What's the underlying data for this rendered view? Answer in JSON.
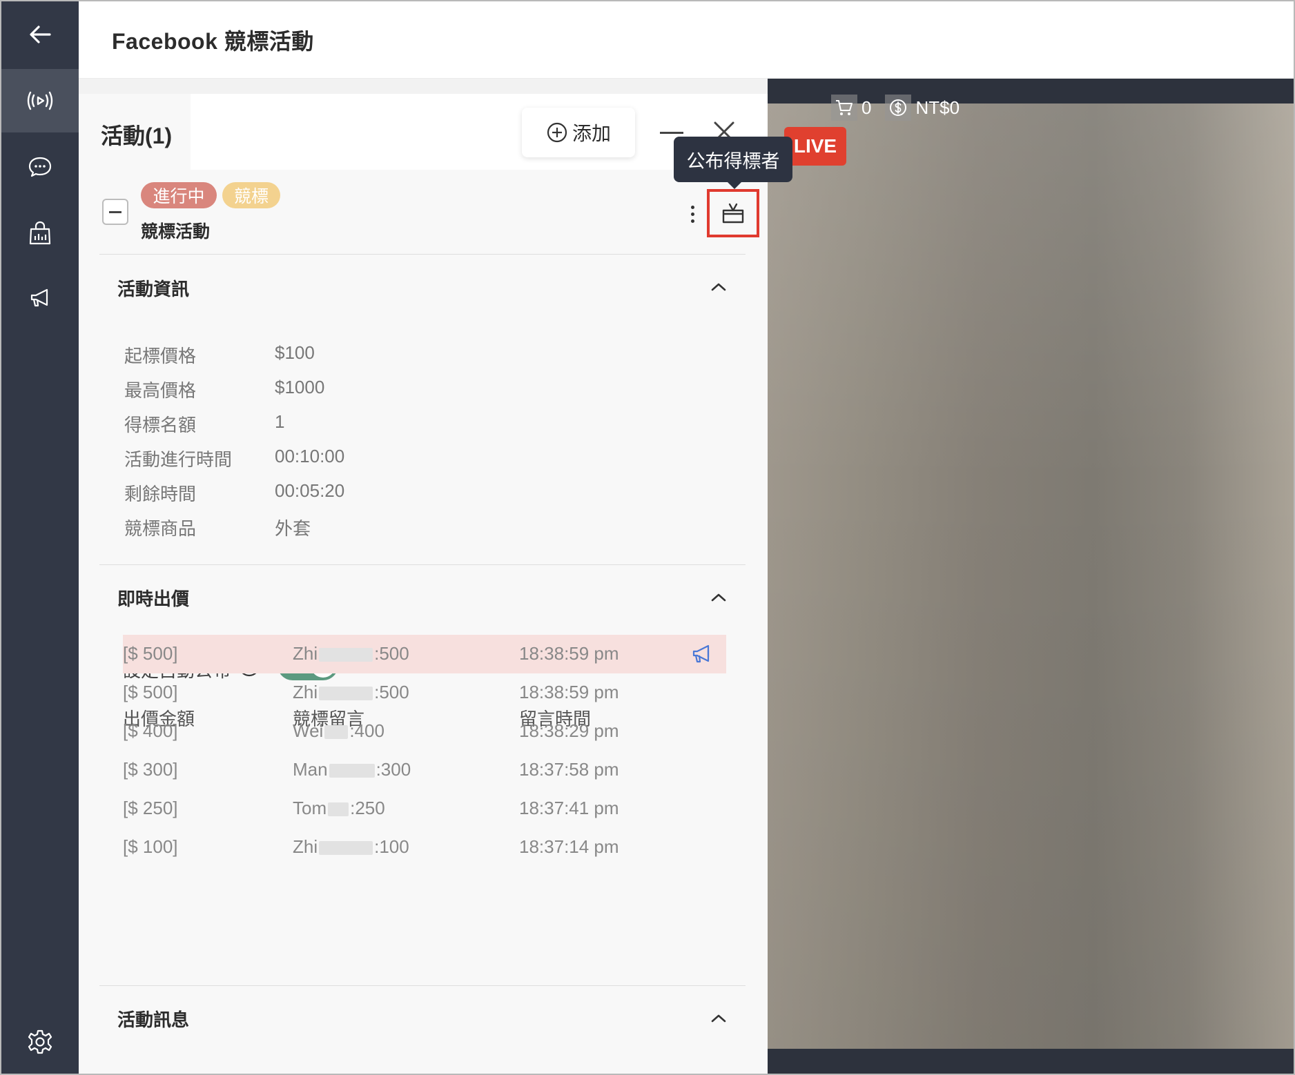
{
  "header": {
    "title": "Facebook 競標活動"
  },
  "sidebar": {
    "items": [
      {
        "name": "back",
        "icon": "arrow-left-icon"
      },
      {
        "name": "live",
        "icon": "broadcast-icon",
        "active": true
      },
      {
        "name": "chat",
        "icon": "chat-bubble-icon"
      },
      {
        "name": "shop",
        "icon": "shopping-bag-icon"
      },
      {
        "name": "announce",
        "icon": "megaphone-icon"
      },
      {
        "name": "settings",
        "icon": "gear-icon"
      }
    ]
  },
  "panel": {
    "title": "活動(1)",
    "add_label": "添加",
    "activity": {
      "status_tag": "進行中",
      "type_tag": "競標",
      "name": "競標活動"
    },
    "tooltip": "公布得標者",
    "info_section": {
      "title": "活動資訊",
      "rows": [
        {
          "label": "起標價格",
          "value": "$100"
        },
        {
          "label": "最高價格",
          "value": "$1000"
        },
        {
          "label": "得標名額",
          "value": "1"
        },
        {
          "label": "活動進行時間",
          "value": "00:10:00"
        },
        {
          "label": "剩餘時間",
          "value": "00:05:20"
        },
        {
          "label": "競標商品",
          "value": "外套"
        }
      ]
    },
    "bids_section": {
      "title": "即時出價",
      "auto_label": "設定自動公布",
      "auto_enabled": true,
      "columns": [
        "出價金額",
        "競標留言",
        "留言時間"
      ],
      "rows": [
        {
          "amount": "[$ 500]",
          "name": "Zhi",
          "msg": ":500",
          "time": "18:38:59 pm",
          "highlight": true
        },
        {
          "amount": "[$ 500]",
          "name": "Zhi",
          "msg": ":500",
          "time": "18:38:59 pm",
          "highlight": false
        },
        {
          "amount": "[$ 400]",
          "name": "Wei",
          "msg": ":400",
          "time": "18:38:29 pm",
          "highlight": false
        },
        {
          "amount": "[$ 300]",
          "name": "Man",
          "msg": ":300",
          "time": "18:37:58 pm",
          "highlight": false
        },
        {
          "amount": "[$ 250]",
          "name": "Tom",
          "msg": ":250",
          "time": "18:37:41 pm",
          "highlight": false
        },
        {
          "amount": "[$ 100]",
          "name": "Zhi",
          "msg": ":100",
          "time": "18:37:14 pm",
          "highlight": false
        }
      ]
    },
    "message_section": {
      "title": "活動訊息"
    }
  },
  "video": {
    "cart_count": "0",
    "amount": "NT$0",
    "live_label": "LIVE"
  },
  "colors": {
    "sidebar_bg": "#323846",
    "status_tag": "#d9867d",
    "type_tag": "#f3d28f",
    "toggle_on": "#5c9a80",
    "highlight_red": "#e03a2f",
    "live_red": "#e0402f"
  }
}
